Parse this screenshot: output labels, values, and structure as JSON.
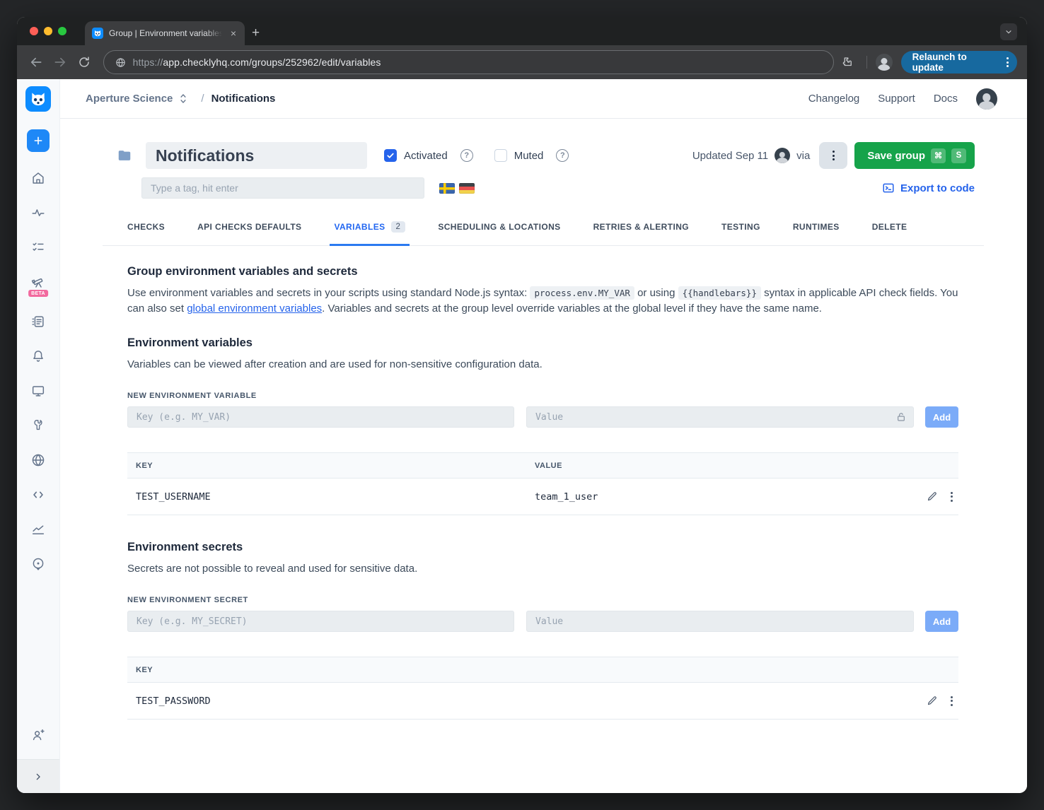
{
  "browser": {
    "tab_title": "Group | Environment variables",
    "new_tab_label": "+",
    "close_tab_label": "×",
    "url_scheme": "https://",
    "url_rest": "app.checklyhq.com/groups/252962/edit/variables",
    "relaunch_label": "Relaunch to update"
  },
  "topnav": {
    "account_name": "Aperture Science",
    "separator": "/",
    "page_name": "Notifications",
    "links": {
      "changelog": "Changelog",
      "support": "Support",
      "docs": "Docs"
    }
  },
  "group_header": {
    "name_value": "Notifications",
    "activated_label": "Activated",
    "activated_checked": true,
    "muted_label": "Muted",
    "muted_checked": false,
    "help_glyph": "?",
    "tag_placeholder": "Type a tag, hit enter",
    "flags": [
      "sweden",
      "germany"
    ],
    "updated_label": "Updated Sep 11",
    "via_label": "via",
    "save_button": "Save group",
    "shortcut_mod": "⌘",
    "shortcut_key": "S",
    "export_link": "Export to code"
  },
  "tabs": [
    {
      "label": "CHECKS"
    },
    {
      "label": "API CHECKS DEFAULTS"
    },
    {
      "label": "VARIABLES",
      "badge": "2",
      "active": true
    },
    {
      "label": "SCHEDULING & LOCATIONS"
    },
    {
      "label": "RETRIES & ALERTING"
    },
    {
      "label": "TESTING"
    },
    {
      "label": "RUNTIMES"
    },
    {
      "label": "DELETE"
    }
  ],
  "content": {
    "section_title": "Group environment variables and secrets",
    "intro": {
      "part1": "Use environment variables and secrets in your scripts using standard Node.js syntax: ",
      "code1": "process.env.MY_VAR",
      "part2": " or using ",
      "code2": "{{handlebars}}",
      "part3": " syntax in applicable API check fields. You can also set ",
      "link": "global environment variables",
      "part4": ". Variables and secrets at the group level override variables at the global level if they have the same name."
    },
    "variables": {
      "heading": "Environment variables",
      "description": "Variables can be viewed after creation and are used for non-sensitive configuration data.",
      "new_label": "NEW ENVIRONMENT VARIABLE",
      "key_placeholder": "Key (e.g. MY_VAR)",
      "value_placeholder": "Value",
      "add_label": "Add",
      "columns": [
        "KEY",
        "VALUE"
      ],
      "rows": [
        {
          "key": "TEST_USERNAME",
          "value": "team_1_user"
        }
      ]
    },
    "secrets": {
      "heading": "Environment secrets",
      "description": "Secrets are not possible to reveal and used for sensitive data.",
      "new_label": "NEW ENVIRONMENT SECRET",
      "key_placeholder": "Key (e.g. MY_SECRET)",
      "value_placeholder": "Value",
      "add_label": "Add",
      "columns": [
        "KEY"
      ],
      "rows": [
        {
          "key": "TEST_PASSWORD"
        }
      ]
    }
  },
  "sidebar": {
    "beta_label": "BETA",
    "icon_names": [
      "checkly-logo",
      "create-plus",
      "home",
      "activity",
      "checks",
      "telescope-beta",
      "runtime-log",
      "alerts-bell",
      "monitor-screen",
      "maintenance",
      "globe",
      "snippets-code",
      "analytics-chart",
      "private-location",
      "invite-user",
      "expand-sidebar"
    ]
  },
  "colors": {
    "brand_blue": "#0d8cff",
    "accent_blue": "#2563eb",
    "active_tab_blue": "#2166f1",
    "save_green": "#16a34a",
    "add_button_blue": "#7babf8",
    "beta_pink": "#f2699e",
    "relaunch_blue": "#17699f",
    "sidebar_bg": "#f7f9fb",
    "chrome_dark": "#1f2122",
    "toolbar_gray": "#3c3d3f"
  }
}
